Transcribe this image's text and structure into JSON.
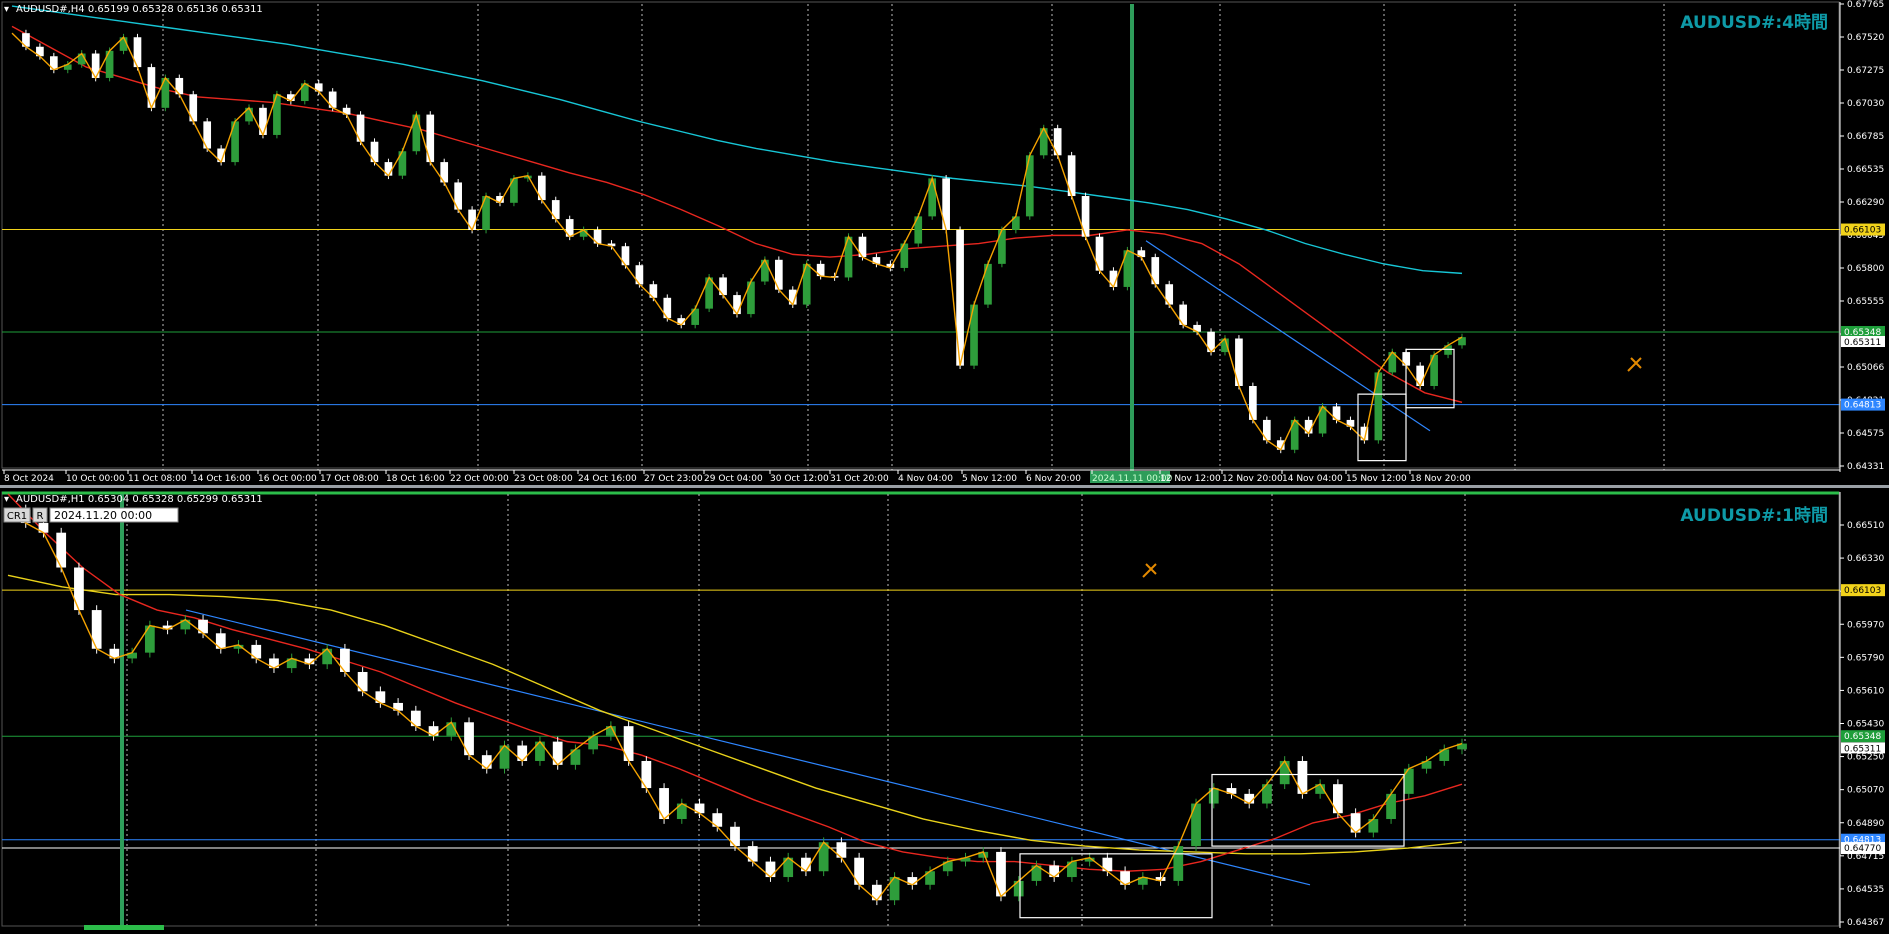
{
  "window": {
    "background": "#000000",
    "grid_color": "#bdbdbd",
    "axis_text_color": "#ffffff",
    "bull_color": "#2e9d3b",
    "bear_color": "#ffffff",
    "divider_color": "#9aa0a6"
  },
  "chart_data": [
    {
      "type": "candlestick",
      "symbol_header": "AUDUSD#,H4  0.65199 0.65328 0.65136 0.65311",
      "watermark": "AUDUSD#:4時間",
      "watermark_color": "#0e9aa7",
      "y_ticks": [
        "0.67765",
        "0.67520",
        "0.67275",
        "0.67030",
        "0.66785",
        "0.66535",
        "0.66290",
        "0.66045",
        "0.65800",
        "0.65555",
        "0.65311",
        "0.65066",
        "0.64821",
        "0.64575",
        "0.64331"
      ],
      "ylim": [
        0.64331,
        0.67765
      ],
      "x_labels": [
        "8 Oct 2024",
        "10 Oct 00:00",
        "11 Oct 08:00",
        "14 Oct 16:00",
        "16 Oct 00:00",
        "17 Oct 08:00",
        "18 Oct 16:00",
        "22 Oct 00:00",
        "23 Oct 08:00",
        "24 Oct 16:00",
        "27 Oct 23:00",
        "29 Oct 04:00",
        "30 Oct 12:00",
        "31 Oct 20:00",
        "4 Nov 04:00",
        "5 Nov 12:00",
        "6 Nov 20:00",
        "2024.11.11 00:00",
        "12 Nov 12:00",
        "12 Nov 20:00",
        "14 Nov 04:00",
        "15 Nov 12:00",
        "18 Nov 20:00"
      ],
      "cursor_label": "2024.11.11 00:00",
      "horizontal_levels": [
        {
          "value": 0.66103,
          "label": "0.66103",
          "color": "#f2d31b"
        },
        {
          "value": 0.65348,
          "label": "0.65348",
          "color": "#1e9e3a"
        },
        {
          "value": 0.64813,
          "label": "0.64813",
          "color": "#2e86ff"
        }
      ],
      "last_price_label": "0.65311",
      "series": [
        {
          "kind": "price_path",
          "values": [
            0.6755,
            0.6745,
            0.6738,
            0.6728,
            0.6732,
            0.674,
            0.6722,
            0.6742,
            0.6752,
            0.673,
            0.67,
            0.6722,
            0.671,
            0.669,
            0.667,
            0.666,
            0.669,
            0.67,
            0.668,
            0.671,
            0.6705,
            0.6718,
            0.6712,
            0.67,
            0.6695,
            0.6675,
            0.666,
            0.665,
            0.6668,
            0.6695,
            0.666,
            0.6645,
            0.6625,
            0.661,
            0.6635,
            0.663,
            0.6648,
            0.665,
            0.6632,
            0.6618,
            0.6605,
            0.661,
            0.66,
            0.6598,
            0.6584,
            0.657,
            0.656,
            0.6545,
            0.654,
            0.6552,
            0.6575,
            0.6562,
            0.6548,
            0.6572,
            0.6588,
            0.6566,
            0.6555,
            0.6585,
            0.6576,
            0.6575,
            0.6605,
            0.659,
            0.6585,
            0.6582,
            0.66,
            0.662,
            0.6648,
            0.661,
            0.651,
            0.6555,
            0.6585,
            0.661,
            0.662,
            0.6665,
            0.6685,
            0.6665,
            0.6635,
            0.6605,
            0.658,
            0.6568,
            0.6595,
            0.659,
            0.657,
            0.6555,
            0.654,
            0.6535,
            0.652,
            0.653,
            0.6495,
            0.647,
            0.6455,
            0.6448,
            0.647,
            0.646,
            0.648,
            0.647,
            0.6465,
            0.6455,
            0.6505,
            0.652,
            0.651,
            0.6495,
            0.6518,
            0.6525,
            0.6531
          ]
        },
        {
          "kind": "zigzag",
          "color": "#f5a300"
        },
        {
          "name": "",
          "kind": "ma_fast",
          "color": "#e8271f",
          "values": [
            0.676,
            0.6745,
            0.673,
            0.6722,
            0.6714,
            0.6708,
            0.6706,
            0.6704,
            0.67,
            0.6696,
            0.669,
            0.6684,
            0.6676,
            0.6668,
            0.666,
            0.6652,
            0.6645,
            0.6636,
            0.6625,
            0.6613,
            0.66,
            0.6592,
            0.659,
            0.6592,
            0.6596,
            0.6598,
            0.66,
            0.6604,
            0.6606,
            0.6606,
            0.661,
            0.6607,
            0.66,
            0.6585,
            0.6565,
            0.6545,
            0.6525,
            0.6505,
            0.649,
            0.6483
          ]
        },
        {
          "name": "",
          "kind": "ma_slow",
          "color": "#17c6d6",
          "values": [
            0.6775,
            0.6771,
            0.6767,
            0.6763,
            0.6759,
            0.6755,
            0.6751,
            0.6747,
            0.6742,
            0.6737,
            0.6732,
            0.6726,
            0.672,
            0.6713,
            0.6706,
            0.6698,
            0.669,
            0.6683,
            0.6676,
            0.667,
            0.6665,
            0.666,
            0.6656,
            0.6652,
            0.6648,
            0.6645,
            0.6642,
            0.6638,
            0.6634,
            0.663,
            0.6625,
            0.6618,
            0.661,
            0.66,
            0.6592,
            0.6585,
            0.658,
            0.6578
          ]
        }
      ]
    },
    {
      "type": "candlestick",
      "symbol_header": "AUDUSD#,H1  0.65304 0.65328 0.65299 0.65311",
      "watermark": "AUDUSD#:1時間",
      "watermark_color": "#0e9aa7",
      "toolbar_tag": "CR1",
      "toolbar_mode": "R",
      "date_field": "2024.11.20  00:00",
      "y_ticks": [
        "0.66510",
        "0.66330",
        "0.66150",
        "0.65970",
        "0.65790",
        "0.65610",
        "0.65430",
        "0.65250",
        "0.65070",
        "0.64890",
        "0.64715",
        "0.64535",
        "0.64367"
      ],
      "ylim": [
        0.64367,
        0.666
      ],
      "horizontal_levels": [
        {
          "value": 0.66103,
          "label": "0.66103",
          "color": "#f2d31b"
        },
        {
          "value": 0.65348,
          "label": "0.65348",
          "color": "#1e9e3a"
        },
        {
          "value": 0.64813,
          "label": "0.64813",
          "color": "#2e86ff"
        },
        {
          "value": 0.6477,
          "label": "0.64770",
          "color": "#ffffff"
        }
      ],
      "last_price_label": "0.65311",
      "series": [
        {
          "kind": "price_path",
          "values": [
            0.6652,
            0.6645,
            0.664,
            0.6622,
            0.66,
            0.658,
            0.6575,
            0.6578,
            0.6592,
            0.659,
            0.6595,
            0.6588,
            0.658,
            0.6582,
            0.6575,
            0.657,
            0.6575,
            0.6572,
            0.658,
            0.6568,
            0.6558,
            0.6552,
            0.6548,
            0.654,
            0.6535,
            0.6542,
            0.6525,
            0.6518,
            0.653,
            0.6522,
            0.6532,
            0.652,
            0.6528,
            0.6535,
            0.654,
            0.6522,
            0.6508,
            0.6492,
            0.65,
            0.6495,
            0.6488,
            0.6478,
            0.647,
            0.6462,
            0.6472,
            0.6465,
            0.648,
            0.6472,
            0.6458,
            0.645,
            0.6462,
            0.6458,
            0.6465,
            0.647,
            0.6472,
            0.6475,
            0.6452,
            0.646,
            0.6468,
            0.6462,
            0.647,
            0.6472,
            0.6465,
            0.6458,
            0.6462,
            0.646,
            0.6478,
            0.65,
            0.6508,
            0.6505,
            0.65,
            0.651,
            0.6522,
            0.6505,
            0.651,
            0.6495,
            0.6485,
            0.6492,
            0.6505,
            0.6518,
            0.6522,
            0.6528,
            0.6531
          ]
        },
        {
          "kind": "zigzag",
          "color": "#f5a300"
        },
        {
          "name": "",
          "kind": "ma_fast",
          "color": "#e8271f",
          "values": [
            0.666,
            0.664,
            0.6622,
            0.6608,
            0.66,
            0.6596,
            0.659,
            0.6585,
            0.658,
            0.6574,
            0.6568,
            0.656,
            0.6552,
            0.6545,
            0.6538,
            0.6532,
            0.653,
            0.6525,
            0.6518,
            0.651,
            0.6502,
            0.6495,
            0.6488,
            0.648,
            0.6475,
            0.6472,
            0.647,
            0.647,
            0.6468,
            0.6466,
            0.6465,
            0.6466,
            0.647,
            0.6476,
            0.6482,
            0.649,
            0.6494,
            0.65,
            0.6504,
            0.651
          ]
        },
        {
          "name": "",
          "kind": "ma_slow",
          "color": "#e9d21a",
          "values": [
            0.6618,
            0.6612,
            0.6608,
            0.6608,
            0.6607,
            0.6605,
            0.66,
            0.6592,
            0.6582,
            0.6572,
            0.656,
            0.6548,
            0.6538,
            0.6528,
            0.6518,
            0.6508,
            0.65,
            0.6492,
            0.6486,
            0.6481,
            0.6478,
            0.6476,
            0.6475,
            0.6474,
            0.6474,
            0.6475,
            0.6477,
            0.648
          ]
        }
      ]
    }
  ]
}
